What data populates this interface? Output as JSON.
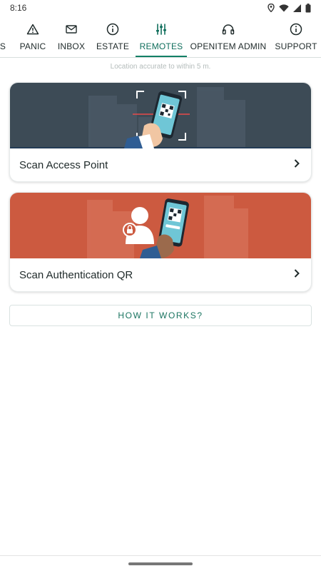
{
  "status_bar": {
    "time": "8:16",
    "icons": [
      "location-icon",
      "wifi-icon",
      "signal-icon",
      "battery-icon"
    ]
  },
  "tabs": [
    {
      "label": "S",
      "icon": "none"
    },
    {
      "label": "PANIC",
      "icon": "warning-icon"
    },
    {
      "label": "INBOX",
      "icon": "mail-icon"
    },
    {
      "label": "ESTATE",
      "icon": "info-icon"
    },
    {
      "label": "REMOTES",
      "icon": "sliders-icon",
      "active": true
    },
    {
      "label": "OPENITEM ADMIN",
      "icon": "headset-icon"
    },
    {
      "label": "SUPPORT",
      "icon": "info-icon"
    }
  ],
  "location_note": "Location accurate to within 5 m.",
  "cards": [
    {
      "label": "Scan Access Point",
      "banner_color": "#3d4b56"
    },
    {
      "label": "Scan Authentication QR",
      "banner_color": "#cc5a40"
    }
  ],
  "how_it_works": "HOW IT WORKS?",
  "colors": {
    "accent": "#138066",
    "card1_banner": "#3d4b56",
    "card2_banner": "#cc5a40"
  }
}
